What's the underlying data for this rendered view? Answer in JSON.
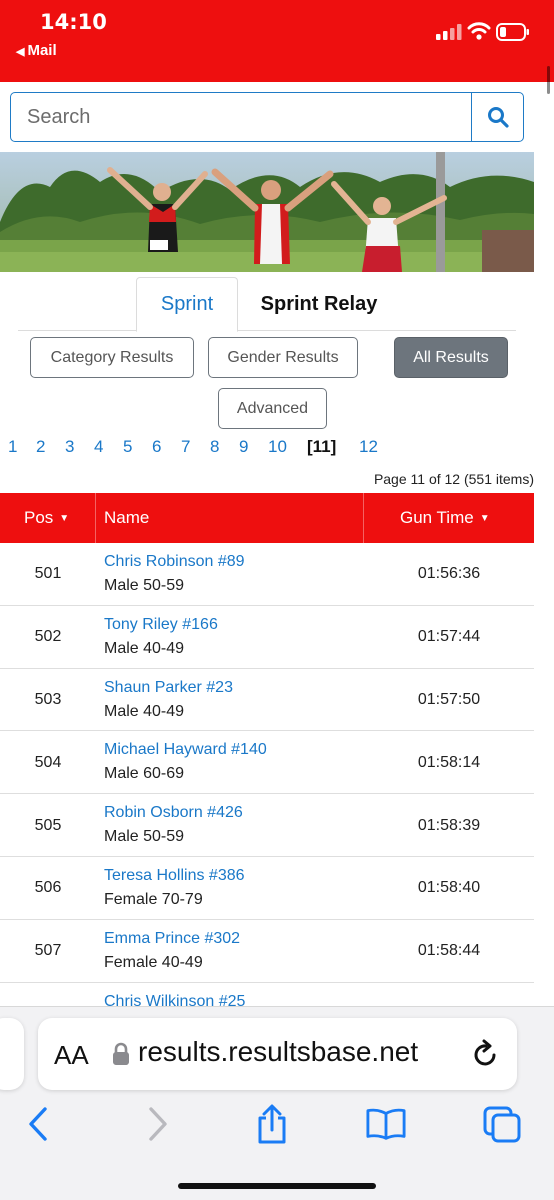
{
  "status_bar": {
    "time": "14:10",
    "back_label": "Mail",
    "bar_color": "#ee0f0f"
  },
  "search": {
    "placeholder": "Search",
    "icon": "search-icon"
  },
  "tabs": [
    {
      "label": "Sprint",
      "active": true
    },
    {
      "label": "Sprint Relay",
      "active": false
    }
  ],
  "filters": {
    "category": "Category Results",
    "gender": "Gender Results",
    "all": "All Results",
    "advanced": "Advanced",
    "selected": "All Results"
  },
  "pagination": {
    "pages": [
      "1",
      "2",
      "3",
      "4",
      "5",
      "6",
      "7",
      "8",
      "9",
      "10",
      "[11]",
      "12"
    ],
    "current_page": 11,
    "info": "Page 11 of 12 (551 items)"
  },
  "table": {
    "headers": {
      "pos": "Pos",
      "name": "Name",
      "time": "Gun Time"
    },
    "rows": [
      {
        "pos": "501",
        "name": "Chris Robinson #89",
        "category": "Male 50-59",
        "time": "01:56:36"
      },
      {
        "pos": "502",
        "name": "Tony Riley #166",
        "category": "Male 40-49",
        "time": "01:57:44"
      },
      {
        "pos": "503",
        "name": "Shaun Parker #23",
        "category": "Male 40-49",
        "time": "01:57:50"
      },
      {
        "pos": "504",
        "name": "Michael Hayward #140",
        "category": "Male 60-69",
        "time": "01:58:14"
      },
      {
        "pos": "505",
        "name": "Robin Osborn #426",
        "category": "Male 50-59",
        "time": "01:58:39"
      },
      {
        "pos": "506",
        "name": "Teresa Hollins #386",
        "category": "Female 70-79",
        "time": "01:58:40"
      },
      {
        "pos": "507",
        "name": "Emma Prince #302",
        "category": "Female 40-49",
        "time": "01:58:44"
      }
    ],
    "partial_row_name": "Chris Wilkinson #25",
    "header_color": "#ee0f0f",
    "link_color": "#1a78c8"
  },
  "browser": {
    "text_size_label": "AA",
    "url": "results.resultsbase.net"
  }
}
